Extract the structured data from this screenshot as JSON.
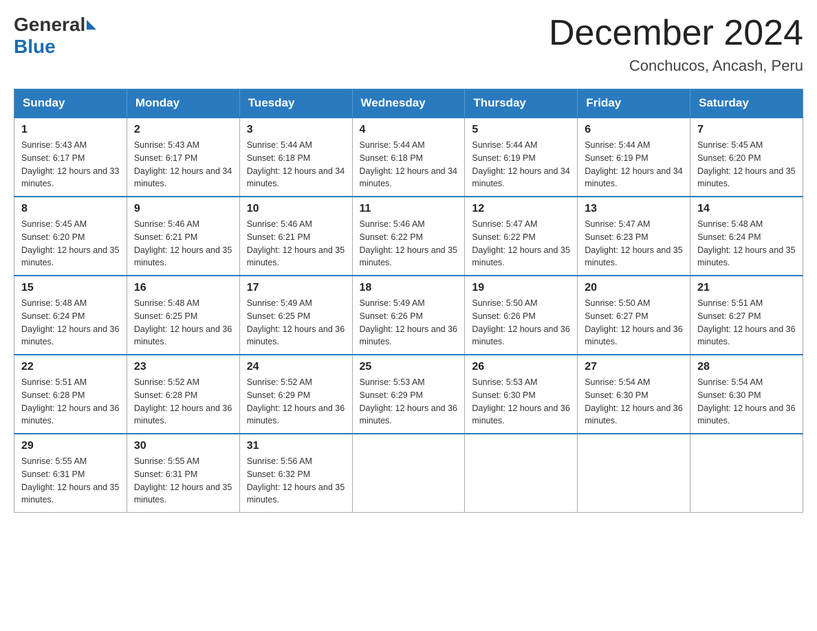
{
  "header": {
    "logo_general": "General",
    "logo_blue": "Blue",
    "month_title": "December 2024",
    "location": "Conchucos, Ancash, Peru"
  },
  "weekdays": [
    "Sunday",
    "Monday",
    "Tuesday",
    "Wednesday",
    "Thursday",
    "Friday",
    "Saturday"
  ],
  "weeks": [
    [
      {
        "day": "1",
        "sunrise": "5:43 AM",
        "sunset": "6:17 PM",
        "daylight": "12 hours and 33 minutes."
      },
      {
        "day": "2",
        "sunrise": "5:43 AM",
        "sunset": "6:17 PM",
        "daylight": "12 hours and 34 minutes."
      },
      {
        "day": "3",
        "sunrise": "5:44 AM",
        "sunset": "6:18 PM",
        "daylight": "12 hours and 34 minutes."
      },
      {
        "day": "4",
        "sunrise": "5:44 AM",
        "sunset": "6:18 PM",
        "daylight": "12 hours and 34 minutes."
      },
      {
        "day": "5",
        "sunrise": "5:44 AM",
        "sunset": "6:19 PM",
        "daylight": "12 hours and 34 minutes."
      },
      {
        "day": "6",
        "sunrise": "5:44 AM",
        "sunset": "6:19 PM",
        "daylight": "12 hours and 34 minutes."
      },
      {
        "day": "7",
        "sunrise": "5:45 AM",
        "sunset": "6:20 PM",
        "daylight": "12 hours and 35 minutes."
      }
    ],
    [
      {
        "day": "8",
        "sunrise": "5:45 AM",
        "sunset": "6:20 PM",
        "daylight": "12 hours and 35 minutes."
      },
      {
        "day": "9",
        "sunrise": "5:46 AM",
        "sunset": "6:21 PM",
        "daylight": "12 hours and 35 minutes."
      },
      {
        "day": "10",
        "sunrise": "5:46 AM",
        "sunset": "6:21 PM",
        "daylight": "12 hours and 35 minutes."
      },
      {
        "day": "11",
        "sunrise": "5:46 AM",
        "sunset": "6:22 PM",
        "daylight": "12 hours and 35 minutes."
      },
      {
        "day": "12",
        "sunrise": "5:47 AM",
        "sunset": "6:22 PM",
        "daylight": "12 hours and 35 minutes."
      },
      {
        "day": "13",
        "sunrise": "5:47 AM",
        "sunset": "6:23 PM",
        "daylight": "12 hours and 35 minutes."
      },
      {
        "day": "14",
        "sunrise": "5:48 AM",
        "sunset": "6:24 PM",
        "daylight": "12 hours and 35 minutes."
      }
    ],
    [
      {
        "day": "15",
        "sunrise": "5:48 AM",
        "sunset": "6:24 PM",
        "daylight": "12 hours and 36 minutes."
      },
      {
        "day": "16",
        "sunrise": "5:48 AM",
        "sunset": "6:25 PM",
        "daylight": "12 hours and 36 minutes."
      },
      {
        "day": "17",
        "sunrise": "5:49 AM",
        "sunset": "6:25 PM",
        "daylight": "12 hours and 36 minutes."
      },
      {
        "day": "18",
        "sunrise": "5:49 AM",
        "sunset": "6:26 PM",
        "daylight": "12 hours and 36 minutes."
      },
      {
        "day": "19",
        "sunrise": "5:50 AM",
        "sunset": "6:26 PM",
        "daylight": "12 hours and 36 minutes."
      },
      {
        "day": "20",
        "sunrise": "5:50 AM",
        "sunset": "6:27 PM",
        "daylight": "12 hours and 36 minutes."
      },
      {
        "day": "21",
        "sunrise": "5:51 AM",
        "sunset": "6:27 PM",
        "daylight": "12 hours and 36 minutes."
      }
    ],
    [
      {
        "day": "22",
        "sunrise": "5:51 AM",
        "sunset": "6:28 PM",
        "daylight": "12 hours and 36 minutes."
      },
      {
        "day": "23",
        "sunrise": "5:52 AM",
        "sunset": "6:28 PM",
        "daylight": "12 hours and 36 minutes."
      },
      {
        "day": "24",
        "sunrise": "5:52 AM",
        "sunset": "6:29 PM",
        "daylight": "12 hours and 36 minutes."
      },
      {
        "day": "25",
        "sunrise": "5:53 AM",
        "sunset": "6:29 PM",
        "daylight": "12 hours and 36 minutes."
      },
      {
        "day": "26",
        "sunrise": "5:53 AM",
        "sunset": "6:30 PM",
        "daylight": "12 hours and 36 minutes."
      },
      {
        "day": "27",
        "sunrise": "5:54 AM",
        "sunset": "6:30 PM",
        "daylight": "12 hours and 36 minutes."
      },
      {
        "day": "28",
        "sunrise": "5:54 AM",
        "sunset": "6:30 PM",
        "daylight": "12 hours and 36 minutes."
      }
    ],
    [
      {
        "day": "29",
        "sunrise": "5:55 AM",
        "sunset": "6:31 PM",
        "daylight": "12 hours and 35 minutes."
      },
      {
        "day": "30",
        "sunrise": "5:55 AM",
        "sunset": "6:31 PM",
        "daylight": "12 hours and 35 minutes."
      },
      {
        "day": "31",
        "sunrise": "5:56 AM",
        "sunset": "6:32 PM",
        "daylight": "12 hours and 35 minutes."
      },
      null,
      null,
      null,
      null
    ]
  ]
}
